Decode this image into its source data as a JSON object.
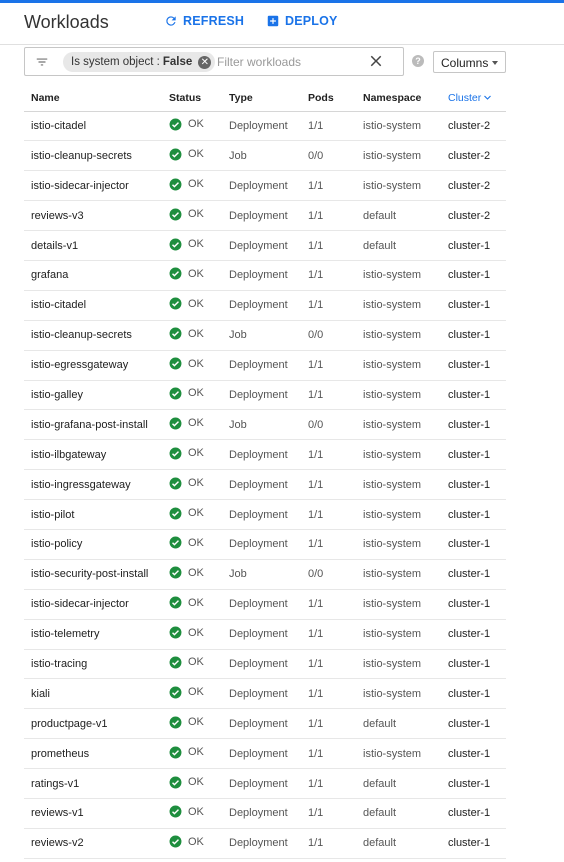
{
  "header": {
    "title": "Workloads",
    "refresh_label": "REFRESH",
    "deploy_label": "DEPLOY"
  },
  "filter": {
    "chip_key": "Is system object :",
    "chip_value": "False",
    "placeholder": "Filter workloads",
    "value": "",
    "columns_label": "Columns"
  },
  "table": {
    "columns": [
      "Name",
      "Status",
      "Type",
      "Pods",
      "Namespace",
      "Cluster"
    ],
    "sorted_column": "Cluster",
    "status_color": "#1e8e3e",
    "rows": [
      {
        "name": "istio-citadel",
        "status": "OK",
        "type": "Deployment",
        "pods": "1/1",
        "namespace": "istio-system",
        "cluster": "cluster-2"
      },
      {
        "name": "istio-cleanup-secrets",
        "status": "OK",
        "type": "Job",
        "pods": "0/0",
        "namespace": "istio-system",
        "cluster": "cluster-2"
      },
      {
        "name": "istio-sidecar-injector",
        "status": "OK",
        "type": "Deployment",
        "pods": "1/1",
        "namespace": "istio-system",
        "cluster": "cluster-2"
      },
      {
        "name": "reviews-v3",
        "status": "OK",
        "type": "Deployment",
        "pods": "1/1",
        "namespace": "default",
        "cluster": "cluster-2"
      },
      {
        "name": "details-v1",
        "status": "OK",
        "type": "Deployment",
        "pods": "1/1",
        "namespace": "default",
        "cluster": "cluster-1"
      },
      {
        "name": "grafana",
        "status": "OK",
        "type": "Deployment",
        "pods": "1/1",
        "namespace": "istio-system",
        "cluster": "cluster-1"
      },
      {
        "name": "istio-citadel",
        "status": "OK",
        "type": "Deployment",
        "pods": "1/1",
        "namespace": "istio-system",
        "cluster": "cluster-1"
      },
      {
        "name": "istio-cleanup-secrets",
        "status": "OK",
        "type": "Job",
        "pods": "0/0",
        "namespace": "istio-system",
        "cluster": "cluster-1"
      },
      {
        "name": "istio-egressgateway",
        "status": "OK",
        "type": "Deployment",
        "pods": "1/1",
        "namespace": "istio-system",
        "cluster": "cluster-1"
      },
      {
        "name": "istio-galley",
        "status": "OK",
        "type": "Deployment",
        "pods": "1/1",
        "namespace": "istio-system",
        "cluster": "cluster-1"
      },
      {
        "name": "istio-grafana-post-install",
        "status": "OK",
        "type": "Job",
        "pods": "0/0",
        "namespace": "istio-system",
        "cluster": "cluster-1"
      },
      {
        "name": "istio-ilbgateway",
        "status": "OK",
        "type": "Deployment",
        "pods": "1/1",
        "namespace": "istio-system",
        "cluster": "cluster-1"
      },
      {
        "name": "istio-ingressgateway",
        "status": "OK",
        "type": "Deployment",
        "pods": "1/1",
        "namespace": "istio-system",
        "cluster": "cluster-1"
      },
      {
        "name": "istio-pilot",
        "status": "OK",
        "type": "Deployment",
        "pods": "1/1",
        "namespace": "istio-system",
        "cluster": "cluster-1"
      },
      {
        "name": "istio-policy",
        "status": "OK",
        "type": "Deployment",
        "pods": "1/1",
        "namespace": "istio-system",
        "cluster": "cluster-1"
      },
      {
        "name": "istio-security-post-install",
        "status": "OK",
        "type": "Job",
        "pods": "0/0",
        "namespace": "istio-system",
        "cluster": "cluster-1"
      },
      {
        "name": "istio-sidecar-injector",
        "status": "OK",
        "type": "Deployment",
        "pods": "1/1",
        "namespace": "istio-system",
        "cluster": "cluster-1"
      },
      {
        "name": "istio-telemetry",
        "status": "OK",
        "type": "Deployment",
        "pods": "1/1",
        "namespace": "istio-system",
        "cluster": "cluster-1"
      },
      {
        "name": "istio-tracing",
        "status": "OK",
        "type": "Deployment",
        "pods": "1/1",
        "namespace": "istio-system",
        "cluster": "cluster-1"
      },
      {
        "name": "kiali",
        "status": "OK",
        "type": "Deployment",
        "pods": "1/1",
        "namespace": "istio-system",
        "cluster": "cluster-1"
      },
      {
        "name": "productpage-v1",
        "status": "OK",
        "type": "Deployment",
        "pods": "1/1",
        "namespace": "default",
        "cluster": "cluster-1"
      },
      {
        "name": "prometheus",
        "status": "OK",
        "type": "Deployment",
        "pods": "1/1",
        "namespace": "istio-system",
        "cluster": "cluster-1"
      },
      {
        "name": "ratings-v1",
        "status": "OK",
        "type": "Deployment",
        "pods": "1/1",
        "namespace": "default",
        "cluster": "cluster-1"
      },
      {
        "name": "reviews-v1",
        "status": "OK",
        "type": "Deployment",
        "pods": "1/1",
        "namespace": "default",
        "cluster": "cluster-1"
      },
      {
        "name": "reviews-v2",
        "status": "OK",
        "type": "Deployment",
        "pods": "1/1",
        "namespace": "default",
        "cluster": "cluster-1"
      }
    ]
  }
}
